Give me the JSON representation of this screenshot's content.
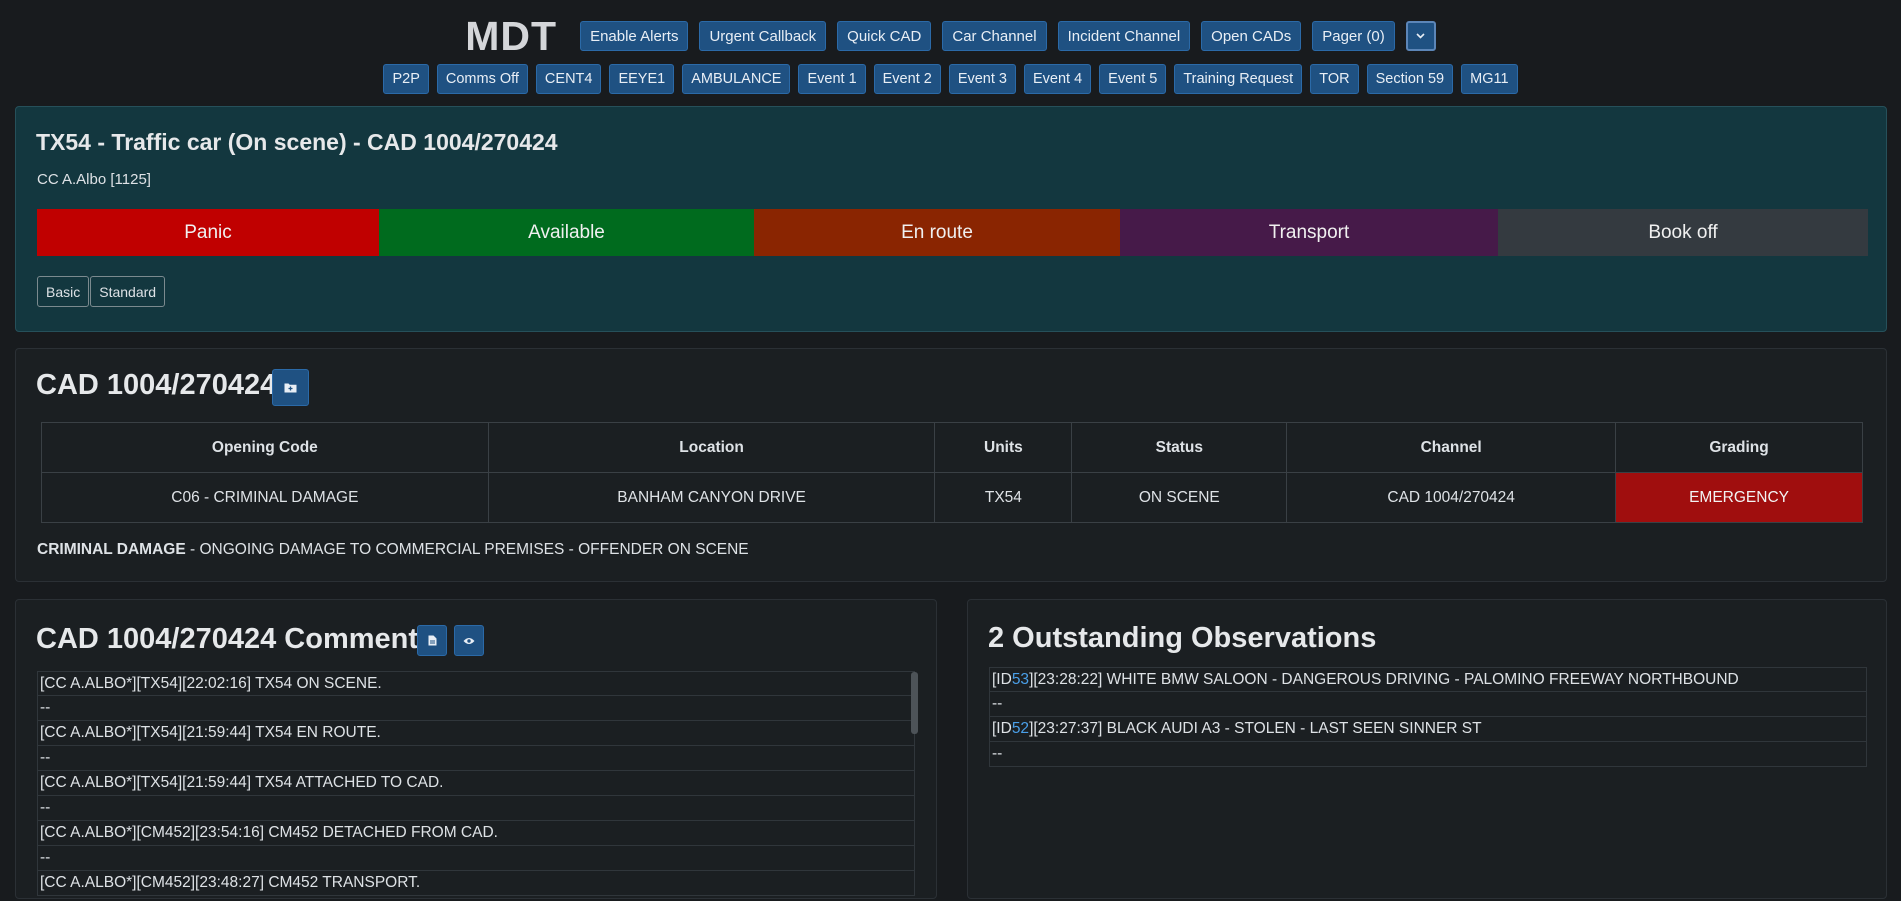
{
  "header": {
    "title": "MDT",
    "buttons": [
      "Enable Alerts",
      "Urgent Callback",
      "Quick CAD",
      "Car Channel",
      "Incident Channel",
      "Open CADs",
      "Pager (0)"
    ],
    "dropdown_icon": "chevron-down-icon"
  },
  "quickbar": {
    "buttons": [
      "P2P",
      "Comms Off",
      "CENT4",
      "EEYE1",
      "AMBULANCE",
      "Event 1",
      "Event 2",
      "Event 3",
      "Event 4",
      "Event 5",
      "Training Request",
      "TOR",
      "Section 59",
      "MG11"
    ]
  },
  "unit": {
    "title": "TX54 - Traffic car (On scene) - CAD 1004/270424",
    "officer": "CC A.Albo [1125]",
    "statuses": {
      "panic": "Panic",
      "available": "Available",
      "en_route": "En route",
      "transport": "Transport",
      "book_off": "Book off"
    },
    "modes": [
      "Basic",
      "Standard"
    ]
  },
  "cad": {
    "title": "CAD 1004/270424",
    "folder_icon": "folder-plus-icon",
    "headers": [
      "Opening Code",
      "Location",
      "Units",
      "Status",
      "Channel",
      "Grading"
    ],
    "row": [
      "C06 - CRIMINAL DAMAGE",
      "BANHAM CANYON DRIVE",
      "TX54",
      "ON SCENE",
      "CAD 1004/270424",
      "EMERGENCY"
    ],
    "description_label": "CRIMINAL DAMAGE",
    "description_text": " - ONGOING DAMAGE TO COMMERCIAL PREMISES - OFFENDER ON SCENE",
    "grading_color": "#a00e0e"
  },
  "comments": {
    "title": "CAD 1004/270424 Comments",
    "doc_icon": "document-icon",
    "eye_icon": "eye-icon",
    "lines": [
      "[CC A.ALBO*][TX54][22:02:16] TX54 ON SCENE.",
      "--",
      "[CC A.ALBO*][TX54][21:59:44] TX54 EN ROUTE.",
      "--",
      "[CC A.ALBO*][TX54][21:59:44] TX54 ATTACHED TO CAD.",
      "--",
      "[CC A.ALBO*][CM452][23:54:16] CM452 DETACHED FROM CAD.",
      "--",
      "[CC A.ALBO*][CM452][23:48:27] CM452 TRANSPORT."
    ]
  },
  "observations": {
    "title": "2 Outstanding Observations",
    "items": [
      {
        "prefix": "[ID ",
        "id": "53",
        "text": "][23:28:22] WHITE BMW SALOON - DANGEROUS DRIVING - PALOMINO FREEWAY NORTHBOUND",
        "sep": "--"
      },
      {
        "prefix": "[ID ",
        "id": "52",
        "text": "][23:27:37] BLACK AUDI A3 - STOLEN - LAST SEEN SINNER ST",
        "sep": "--"
      }
    ]
  },
  "colors": {
    "panic": "#c00000",
    "available": "#006b1e",
    "en_route": "#8a2501",
    "transport": "#461a49",
    "book_off": "#343a40",
    "button": "#1f5182",
    "link": "#4a9fe8"
  }
}
